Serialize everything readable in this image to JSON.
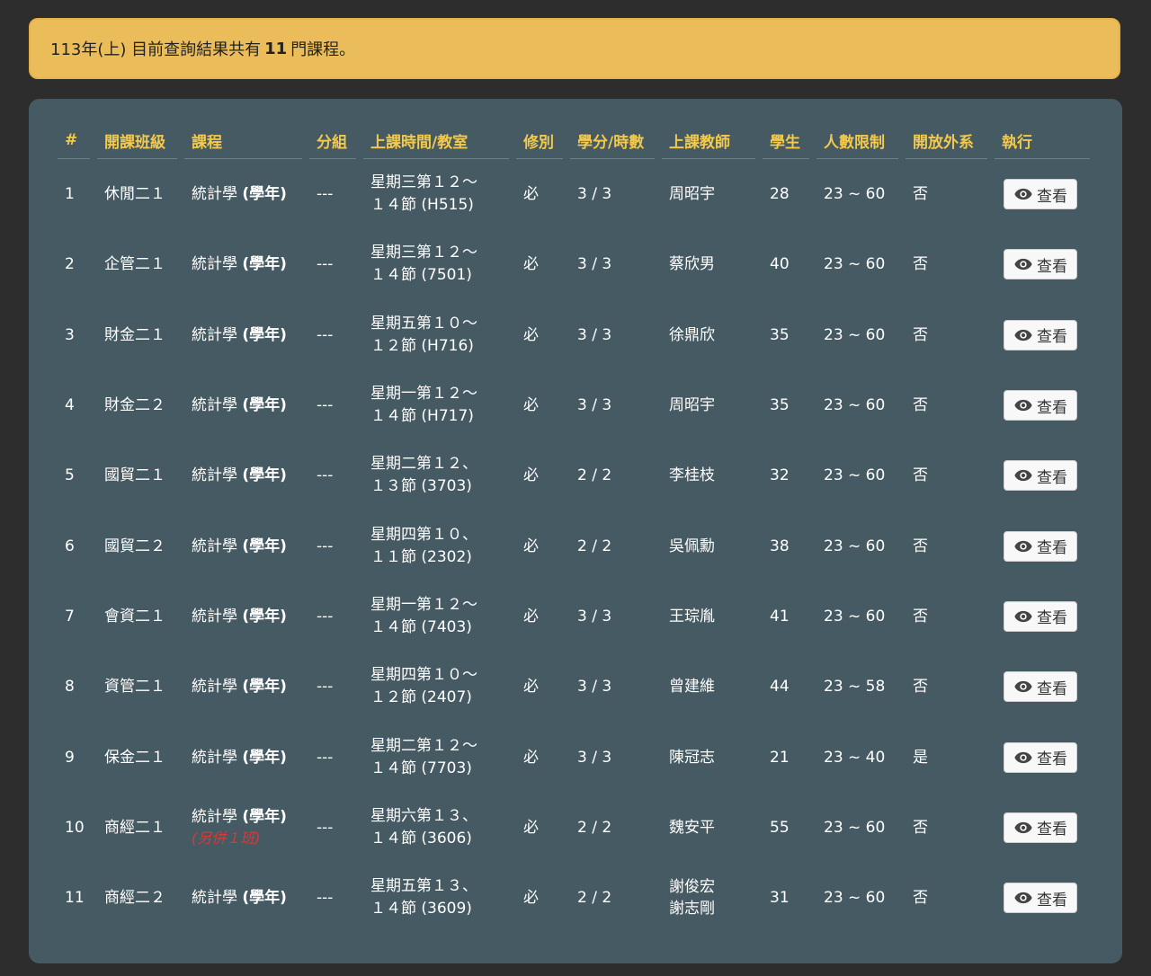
{
  "alert": {
    "prefix": "113年(上) 目前查詢結果共有",
    "count": "11",
    "suffix": "門課程。"
  },
  "table": {
    "headers": [
      "#",
      "開課班級",
      "課程",
      "分組",
      "上課時間/教室",
      "修別",
      "學分/時數",
      "上課教師",
      "學生",
      "人數限制",
      "開放外系",
      "執行"
    ],
    "view_label": "查看",
    "rows": [
      {
        "num": "1",
        "class": "休閒二１",
        "course": "統計學",
        "course_tag": "(學年)",
        "course_extra": "",
        "group": "---",
        "time1": "星期三第１２～",
        "time2": "１４節 (H515)",
        "type": "必",
        "credits": "3 / 3",
        "teacher1": "周昭宇",
        "teacher2": "",
        "students": "28",
        "limit": "23 ~ 60",
        "open": "否"
      },
      {
        "num": "2",
        "class": "企管二１",
        "course": "統計學",
        "course_tag": "(學年)",
        "course_extra": "",
        "group": "---",
        "time1": "星期三第１２～",
        "time2": "１４節 (7501)",
        "type": "必",
        "credits": "3 / 3",
        "teacher1": "蔡欣男",
        "teacher2": "",
        "students": "40",
        "limit": "23 ~ 60",
        "open": "否"
      },
      {
        "num": "3",
        "class": "財金二１",
        "course": "統計學",
        "course_tag": "(學年)",
        "course_extra": "",
        "group": "---",
        "time1": "星期五第１０～",
        "time2": "１２節 (H716)",
        "type": "必",
        "credits": "3 / 3",
        "teacher1": "徐鼎欣",
        "teacher2": "",
        "students": "35",
        "limit": "23 ~ 60",
        "open": "否"
      },
      {
        "num": "4",
        "class": "財金二２",
        "course": "統計學",
        "course_tag": "(學年)",
        "course_extra": "",
        "group": "---",
        "time1": "星期一第１２～",
        "time2": "１４節 (H717)",
        "type": "必",
        "credits": "3 / 3",
        "teacher1": "周昭宇",
        "teacher2": "",
        "students": "35",
        "limit": "23 ~ 60",
        "open": "否"
      },
      {
        "num": "5",
        "class": "國貿二１",
        "course": "統計學",
        "course_tag": "(學年)",
        "course_extra": "",
        "group": "---",
        "time1": "星期二第１２、",
        "time2": "１３節 (3703)",
        "type": "必",
        "credits": "2 / 2",
        "teacher1": "李桂枝",
        "teacher2": "",
        "students": "32",
        "limit": "23 ~ 60",
        "open": "否"
      },
      {
        "num": "6",
        "class": "國貿二２",
        "course": "統計學",
        "course_tag": "(學年)",
        "course_extra": "",
        "group": "---",
        "time1": "星期四第１０、",
        "time2": "１１節 (2302)",
        "type": "必",
        "credits": "2 / 2",
        "teacher1": "吳佩勳",
        "teacher2": "",
        "students": "38",
        "limit": "23 ~ 60",
        "open": "否"
      },
      {
        "num": "7",
        "class": "會資二１",
        "course": "統計學",
        "course_tag": "(學年)",
        "course_extra": "",
        "group": "---",
        "time1": "星期一第１２～",
        "time2": "１４節 (7403)",
        "type": "必",
        "credits": "3 / 3",
        "teacher1": "王琮胤",
        "teacher2": "",
        "students": "41",
        "limit": "23 ~ 60",
        "open": "否"
      },
      {
        "num": "8",
        "class": "資管二１",
        "course": "統計學",
        "course_tag": "(學年)",
        "course_extra": "",
        "group": "---",
        "time1": "星期四第１０～",
        "time2": "１２節 (2407)",
        "type": "必",
        "credits": "3 / 3",
        "teacher1": "曾建維",
        "teacher2": "",
        "students": "44",
        "limit": "23 ~ 58",
        "open": "否"
      },
      {
        "num": "9",
        "class": "保金二１",
        "course": "統計學",
        "course_tag": "(學年)",
        "course_extra": "",
        "group": "---",
        "time1": "星期二第１２～",
        "time2": "１４節 (7703)",
        "type": "必",
        "credits": "3 / 3",
        "teacher1": "陳冠志",
        "teacher2": "",
        "students": "21",
        "limit": "23 ~ 40",
        "open": "是"
      },
      {
        "num": "10",
        "class": "商經二１",
        "course": "統計學",
        "course_tag": "(學年)",
        "course_extra": "(另併１班)",
        "group": "---",
        "time1": "星期六第１３、",
        "time2": "１４節 (3606)",
        "type": "必",
        "credits": "2 / 2",
        "teacher1": "魏安平",
        "teacher2": "",
        "students": "55",
        "limit": "23 ~ 60",
        "open": "否"
      },
      {
        "num": "11",
        "class": "商經二２",
        "course": "統計學",
        "course_tag": "(學年)",
        "course_extra": "",
        "group": "---",
        "time1": "星期五第１３、",
        "time2": "１４節 (3609)",
        "type": "必",
        "credits": "2 / 2",
        "teacher1": "謝俊宏",
        "teacher2": "謝志剛",
        "students": "31",
        "limit": "23 ~ 60",
        "open": "否"
      }
    ]
  }
}
